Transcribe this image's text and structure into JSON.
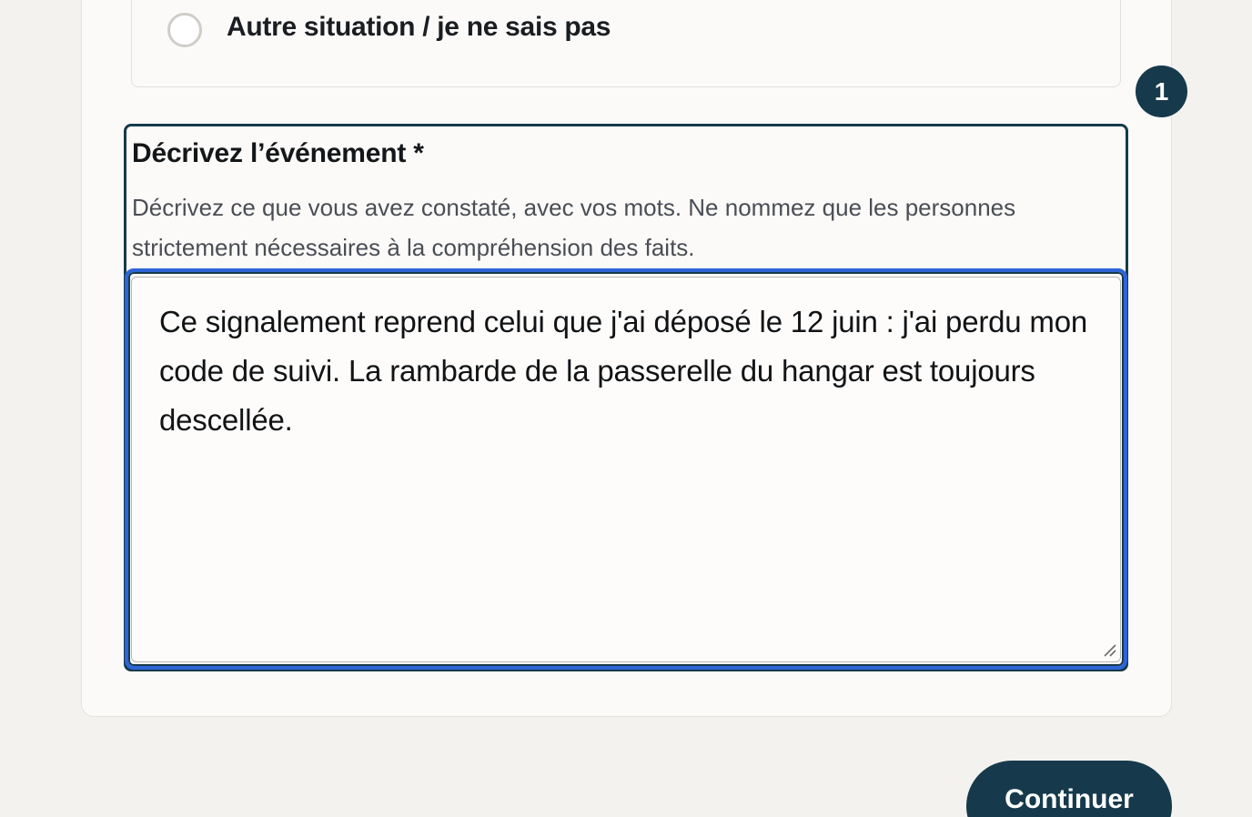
{
  "option": {
    "label": "Autre situation / je ne sais pas"
  },
  "step": {
    "number": "1"
  },
  "event_field": {
    "title": "Décrivez l’événement *",
    "help": "Décrivez ce que vous avez constaté, avec vos mots. Ne nommez que les personnes strictement nécessaires à la compréhension des faits.",
    "value": "Ce signalement reprend celui que j'ai déposé le 12 juin : j'ai perdu mon code de suivi. La rambarde de la passerelle du hangar est toujours descellée."
  },
  "actions": {
    "continue_label": "Continuer"
  },
  "colors": {
    "primary": "#163a4c",
    "focus": "#2e64d6",
    "background": "#f3f2ef"
  }
}
